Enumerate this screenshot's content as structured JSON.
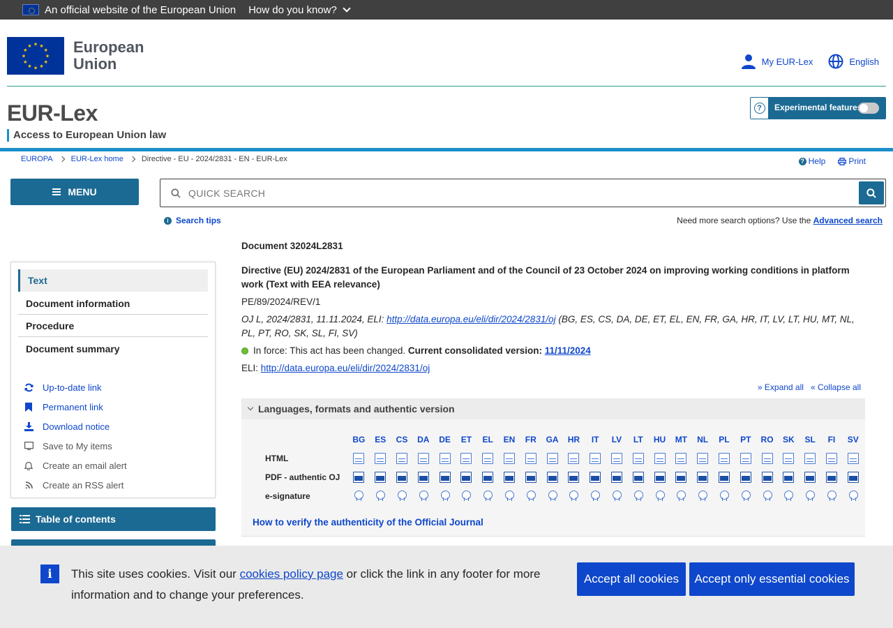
{
  "topbar": {
    "official_text": "An official website of the European Union",
    "how_text": "How do you know?"
  },
  "header": {
    "eu_name_line1": "European",
    "eu_name_line2": "Union",
    "my_eurlex": "My EUR-Lex",
    "language": "English",
    "site_title": "EUR-Lex",
    "site_subtitle": "Access to European Union law",
    "experimental_label": "Experimental features",
    "experimental_enabled": false
  },
  "breadcrumb": [
    "EUROPA",
    "EUR-Lex home",
    "Directive - EU - 2024/2831 - EN - EUR-Lex"
  ],
  "utilities": {
    "help": "Help",
    "print": "Print"
  },
  "menu": {
    "label": "MENU"
  },
  "search": {
    "placeholder": "QUICK SEARCH",
    "tips": "Search tips",
    "advanced_prefix": "Need more search options? Use the",
    "advanced_link": "Advanced search"
  },
  "sidebar": {
    "tabs": [
      "Text",
      "Document information",
      "Procedure",
      "Document summary"
    ],
    "links": [
      "Up-to-date link",
      "Permanent link",
      "Download notice",
      "Save to My items",
      "Create an email alert",
      "Create an RSS alert"
    ],
    "toc": "Table of contents"
  },
  "document": {
    "number": "Document 32024L2831",
    "title": "Directive (EU) 2024/2831 of the European Parliament and of the Council of 23 October 2024 on improving working conditions in platform work (Text with EEA relevance)",
    "ref": "PE/89/2024/REV/1",
    "oj_prefix": "OJ L, 2024/2831, 11.11.2024, ELI: ",
    "oj_link": "http://data.europa.eu/eli/dir/2024/2831/oj",
    "oj_langs": " (BG, ES, CS, DA, DE, ET, EL, EN, FR, GA, HR, IT, LV, LT, HU, MT, NL, PL, PT, RO, SK, SL, FI, SV)",
    "status_text": "In force: This act has been changed. ",
    "consolidated_label": "Current consolidated version: ",
    "consolidated_date": "11/11/2024",
    "eli_label": "ELI: ",
    "eli_link": "http://data.europa.eu/eli/dir/2024/2831/oj",
    "expand_all": "Expand all",
    "collapse_all": "Collapse all"
  },
  "languages": {
    "heading": "Languages, formats and authentic version",
    "codes": [
      "BG",
      "ES",
      "CS",
      "DA",
      "DE",
      "ET",
      "EL",
      "EN",
      "FR",
      "GA",
      "HR",
      "IT",
      "LV",
      "LT",
      "HU",
      "MT",
      "NL",
      "PL",
      "PT",
      "RO",
      "SK",
      "SL",
      "FI",
      "SV"
    ],
    "rows": [
      "HTML",
      "PDF - authentic OJ",
      "e-signature"
    ],
    "verify_link": "How to verify the authenticity of the Official Journal"
  },
  "cookie": {
    "text_before": "This site uses cookies. Visit our ",
    "policy_link": "cookies policy page",
    "text_after": " or click the link in any footer for more information and to change your preferences.",
    "accept_all": "Accept all cookies",
    "accept_essential": "Accept only essential cookies"
  },
  "colors": {
    "primary": "#1b6a93",
    "link": "#0e47cb",
    "accent_strip": "#1a8fc9",
    "in_force": "#6fbe36"
  }
}
